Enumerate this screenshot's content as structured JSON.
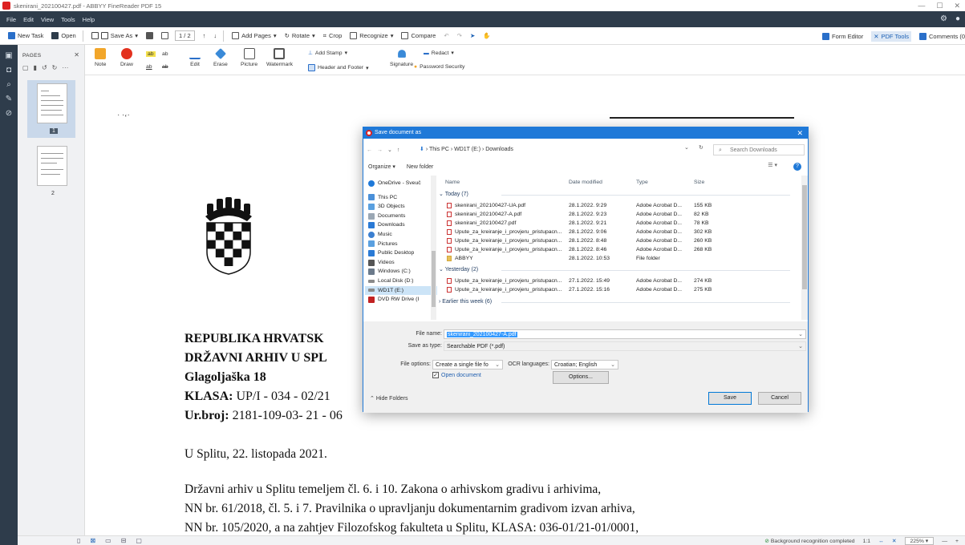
{
  "window": {
    "title": "skenirani_202100427.pdf - ABBYY FineReader PDF 15",
    "controls": [
      "—",
      "☐",
      "✕"
    ]
  },
  "menu": [
    "File",
    "Edit",
    "View",
    "Tools",
    "Help"
  ],
  "toolbar": {
    "new_task": "New Task",
    "open": "Open",
    "save_as": "Save As",
    "page_indicator": "1 / 2",
    "add_pages": "Add Pages",
    "rotate": "Rotate",
    "crop": "Crop",
    "recognize": "Recognize",
    "compare": "Compare",
    "form_editor": "Form Editor",
    "pdf_tools": "PDF Tools",
    "comments": "Comments (0"
  },
  "pages_panel": {
    "heading": "PAGES",
    "page1_num": "1",
    "page2_num": "2"
  },
  "ribbon": {
    "note": "Note",
    "draw": "Draw",
    "edit": "Edit",
    "erase": "Erase",
    "picture": "Picture",
    "watermark": "Watermark",
    "add_stamp": "Add Stamp",
    "header_footer": "Header and Footer",
    "signature": "Signature",
    "redact": "Redact",
    "password_security": "Password Security"
  },
  "document": {
    "line1": "REPUBLIKA HRVATSK",
    "line2": "DRŽAVNI ARHIV U SPL",
    "line3": "Glagoljaška 18",
    "klasa_label": "KLASA:",
    "klasa_value": " UP/I - 034 - 02/21",
    "urbroj_label": "Ur.broj:",
    "urbroj_value": " 2181-109-03- 21 - 06",
    "date_line": "U Splitu, 22. listopada 2021.",
    "para1": "Državni arhiv u Splitu temeljem čl. 6. i 10. Zakona o arhivskom gradivu i arhivima,",
    "para2": "NN br. 61/2018,  čl. 5. i  7. Pravilnika o upravljanju dokumentarnim gradivom izvan arhiva,",
    "para3": "NN br. 105/2020, a na zahtjev Filozofskog fakulteta u Splitu, KLASA: 036-01/21-01/0001,"
  },
  "statusbar": {
    "status": "Background recognition completed",
    "page_fit": "1:1",
    "zoom": "225%"
  },
  "dialog": {
    "title": "Save document as",
    "breadcrumb": "This PC  ›  WD1T (E:)  ›  Downloads",
    "search_placeholder": "Search Downloads",
    "organize": "Organize ▾",
    "new_folder": "New folder",
    "nav": [
      {
        "label": "OneDrive - Sveuč",
        "color": "#1f79d8"
      },
      {
        "label": "This PC",
        "color": "#4a90d9"
      },
      {
        "label": "3D Objects",
        "color": "#5aa0e0"
      },
      {
        "label": "Documents",
        "color": "#9aa7b4"
      },
      {
        "label": "Downloads",
        "color": "#2a7ad5"
      },
      {
        "label": "Music",
        "color": "#3b7fd0"
      },
      {
        "label": "Pictures",
        "color": "#5aa0e0"
      },
      {
        "label": "Public Desktop",
        "color": "#2a7ad5"
      },
      {
        "label": "Videos",
        "color": "#555555"
      },
      {
        "label": "Windows (C:)",
        "color": "#6b7a8a"
      },
      {
        "label": "Local Disk (D:)",
        "color": "#8a8a8a"
      },
      {
        "label": "WD1T (E:)",
        "color": "#8a8a8a"
      },
      {
        "label": "DVD RW Drive (I",
        "color": "#c22222"
      }
    ],
    "columns": {
      "name": "Name",
      "date": "Date modified",
      "type": "Type",
      "size": "Size"
    },
    "groups": {
      "today": "Today (7)",
      "yesterday": "Yesterday (2)",
      "earlier": "Earlier this week (6)"
    },
    "files_today": [
      {
        "name": "skenirani_202100427-UA.pdf",
        "date": "28.1.2022. 9:29",
        "type": "Adobe Acrobat D...",
        "size": "155 KB"
      },
      {
        "name": "skenirani_202100427-A.pdf",
        "date": "28.1.2022. 9:23",
        "type": "Adobe Acrobat D...",
        "size": "82 KB"
      },
      {
        "name": "skenirani_202100427.pdf",
        "date": "28.1.2022. 9:21",
        "type": "Adobe Acrobat D...",
        "size": "78 KB"
      },
      {
        "name": "Upute_za_kreiranje_i_provjeru_pristupacn...",
        "date": "28.1.2022. 9:06",
        "type": "Adobe Acrobat D...",
        "size": "302 KB"
      },
      {
        "name": "Upute_za_kreiranje_i_provjeru_pristupacn...",
        "date": "28.1.2022. 8:48",
        "type": "Adobe Acrobat D...",
        "size": "260 KB"
      },
      {
        "name": "Upute_za_kreiranje_i_provjeru_pristupacn...",
        "date": "28.1.2022. 8:46",
        "type": "Adobe Acrobat D...",
        "size": "268 KB"
      },
      {
        "name": "ABBYY",
        "date": "28.1.2022. 10:53",
        "type": "File folder",
        "size": ""
      }
    ],
    "files_yesterday": [
      {
        "name": "Upute_za_kreiranje_i_provjeru_pristupacn...",
        "date": "27.1.2022. 15:49",
        "type": "Adobe Acrobat D...",
        "size": "274 KB"
      },
      {
        "name": "Upute_za_kreiranje_i_provjeru_pristupacn...",
        "date": "27.1.2022. 15:16",
        "type": "Adobe Acrobat D...",
        "size": "275 KB"
      }
    ],
    "file_name_label": "File name:",
    "file_name_value": "skenirani_202100427-A.pdf",
    "save_type_label": "Save as type:",
    "save_type_value": "Searchable PDF (*.pdf)",
    "file_options_label": "File options:",
    "file_options_value": "Create a single file fo",
    "ocr_label": "OCR languages:",
    "ocr_value": "Croatian; English",
    "open_doc_label": "Open document",
    "options_button": "Options...",
    "hide_folders": "Hide Folders",
    "save_button": "Save",
    "cancel_button": "Cancel"
  }
}
